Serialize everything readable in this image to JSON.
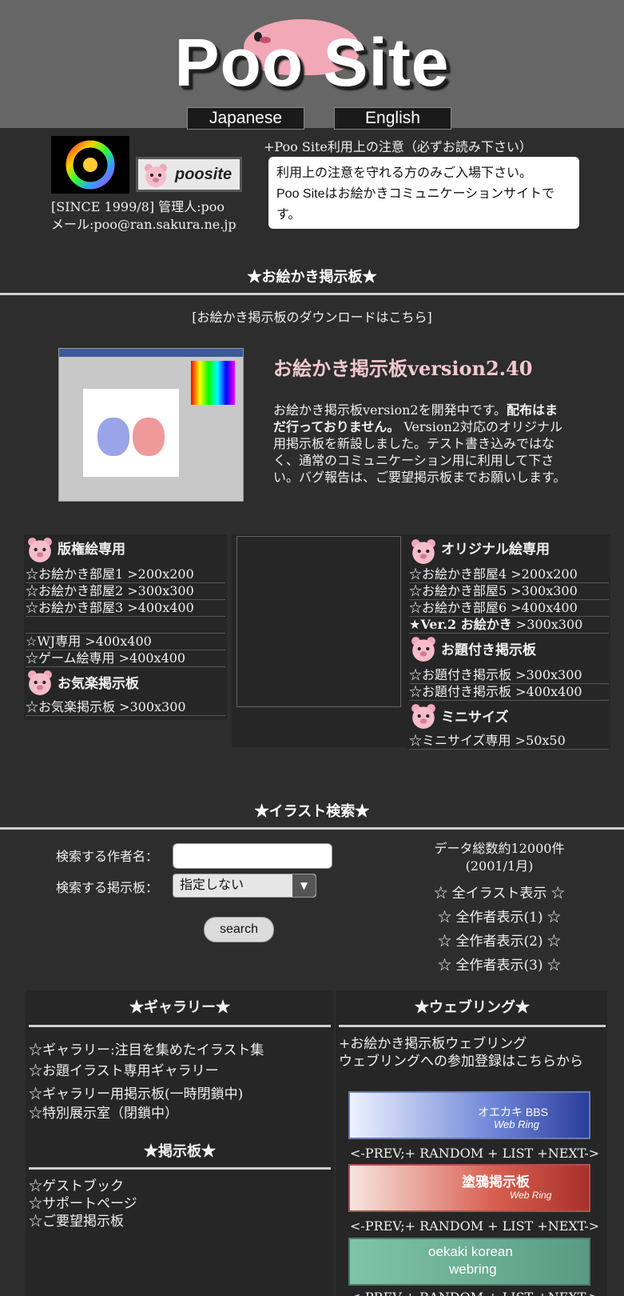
{
  "header": {
    "title": "Poo Site",
    "lang": [
      "Japanese",
      "English"
    ]
  },
  "intro": {
    "notice_title": "+Poo Site利用上の注意（必ずお読み下さい）",
    "notice_line1": "利用上の注意を守れる方のみご入場下さい。",
    "notice_line2": "Poo Siteはお絵かきコミュニケーションサイトです。",
    "since": "[SINCE 1999/8] 管理人:poo",
    "mail": "メール:poo@ran.sakura.ne.jp",
    "badge": "poosite"
  },
  "oekaki": {
    "section_title": "★お絵かき掲示板★",
    "download": "[お絵かき掲示板のダウンロードはこちら]",
    "version_title": "お絵かき掲示板version2.40",
    "desc_a": "お絵かき掲示板version2を開発中です。",
    "desc_b": "配布はまだ行っておりません。",
    "desc_c": " Version2対応のオリジナル用掲示板を新設しました。テスト書き込みではなく、通常のコミュニケーション用に利用して下さい。バグ報告は、ご要望掲示板までお願いします。",
    "left": {
      "head1": "版権絵専用",
      "rooms1": [
        "☆お絵かき部屋1 >200x200",
        "☆お絵かき部屋2 >300x300",
        "☆お絵かき部屋3 >400x400"
      ],
      "rooms2": [
        "☆WJ専用 >400x400",
        "☆ゲーム絵専用 >400x400"
      ],
      "head2": "お気楽掲示板",
      "rooms3": [
        "☆お気楽掲示板 >300x300"
      ]
    },
    "right": {
      "head1": "オリジナル絵専用",
      "rooms1": [
        "☆お絵かき部屋4 >200x200",
        "☆お絵かき部屋5 >300x300",
        "☆お絵かき部屋6 >400x400"
      ],
      "ver2_a": "★",
      "ver2_b": "Ver.2 お絵かき",
      "ver2_c": " >300x300",
      "head2": "お題付き掲示板",
      "rooms2": [
        "☆お題付き掲示板 >300x300",
        "☆お題付き掲示板 >400x400"
      ],
      "head3": "ミニサイズ",
      "rooms3": [
        "☆ミニサイズ専用 >50x50"
      ]
    }
  },
  "search": {
    "section_title": "★イラスト検索★",
    "author_label": "検索する作者名：",
    "board_label": "検索する掲示板：",
    "board_value": "指定しない",
    "button": "search",
    "stats1": "データ総数約12000件",
    "stats2": "(2001/1月)",
    "links": [
      "☆ 全イラスト表示 ☆",
      "☆ 全作者表示(1) ☆",
      "☆ 全作者表示(2) ☆",
      "☆ 全作者表示(3) ☆"
    ]
  },
  "gallery": {
    "title": "★ギャラリー★",
    "items": [
      "☆ギャラリー:注目を集めたイラスト集",
      "☆お題イラスト専用ギャラリー",
      "☆ギャラリー用掲示板(一時閉鎖中)",
      "☆特別展示室（閉鎖中）"
    ],
    "board_title": "★掲示板★",
    "board_items": [
      "☆ゲストブック",
      "☆サポートページ",
      "☆ご要望掲示板"
    ]
  },
  "webring": {
    "title": "★ウェブリング★",
    "line1": "+お絵かき掲示板ウェブリング",
    "line2": "ウェブリングへの参加登録はこちらから",
    "banner1": "オエカキ BBS",
    "banner1b": "Web Ring",
    "banner2": "塗鴉掲示板",
    "banner2b": "Web Ring",
    "banner3": "oekaki korean",
    "banner3b": "webring",
    "nav": "<-PREV;+ RANDOM + LIST +NEXT->",
    "nav_partial": "<-PREV;+ RANDOM + LIST +NEXT->"
  }
}
